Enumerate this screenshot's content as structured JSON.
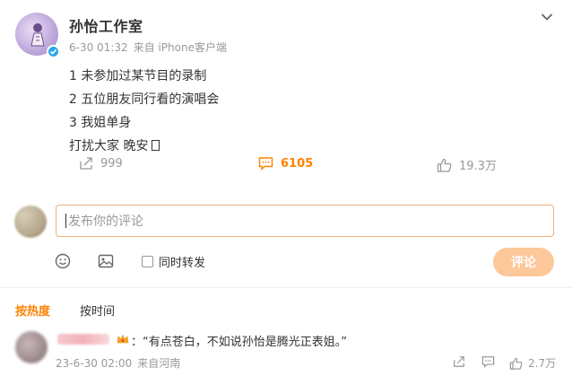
{
  "post": {
    "author": "孙怡工作室",
    "date": "6-30 01:32",
    "source": "来自 iPhone客户端",
    "lines": [
      "1 未参加过某节目的录制",
      "2 五位朋友同行看的演唱会",
      "3 我姐单身",
      "打扰大家 晚安"
    ],
    "actions": {
      "repost": "999",
      "comment": "6105",
      "like": "19.3万"
    }
  },
  "composer": {
    "placeholder": "发布你的评论",
    "repost_label": "同时转发",
    "submit_label": "评论"
  },
  "sort": {
    "hot": "按热度",
    "time": "按时间"
  },
  "comment": {
    "text": "：“有点苍白，不如说孙怡是腾光正表姐。”",
    "date": "23-6-30 02:00",
    "source": "来自河南",
    "likes": "2.7万"
  },
  "colors": {
    "accent": "#ff8200",
    "submit_bg": "#fdc79a",
    "input_border": "#f0b37a"
  }
}
